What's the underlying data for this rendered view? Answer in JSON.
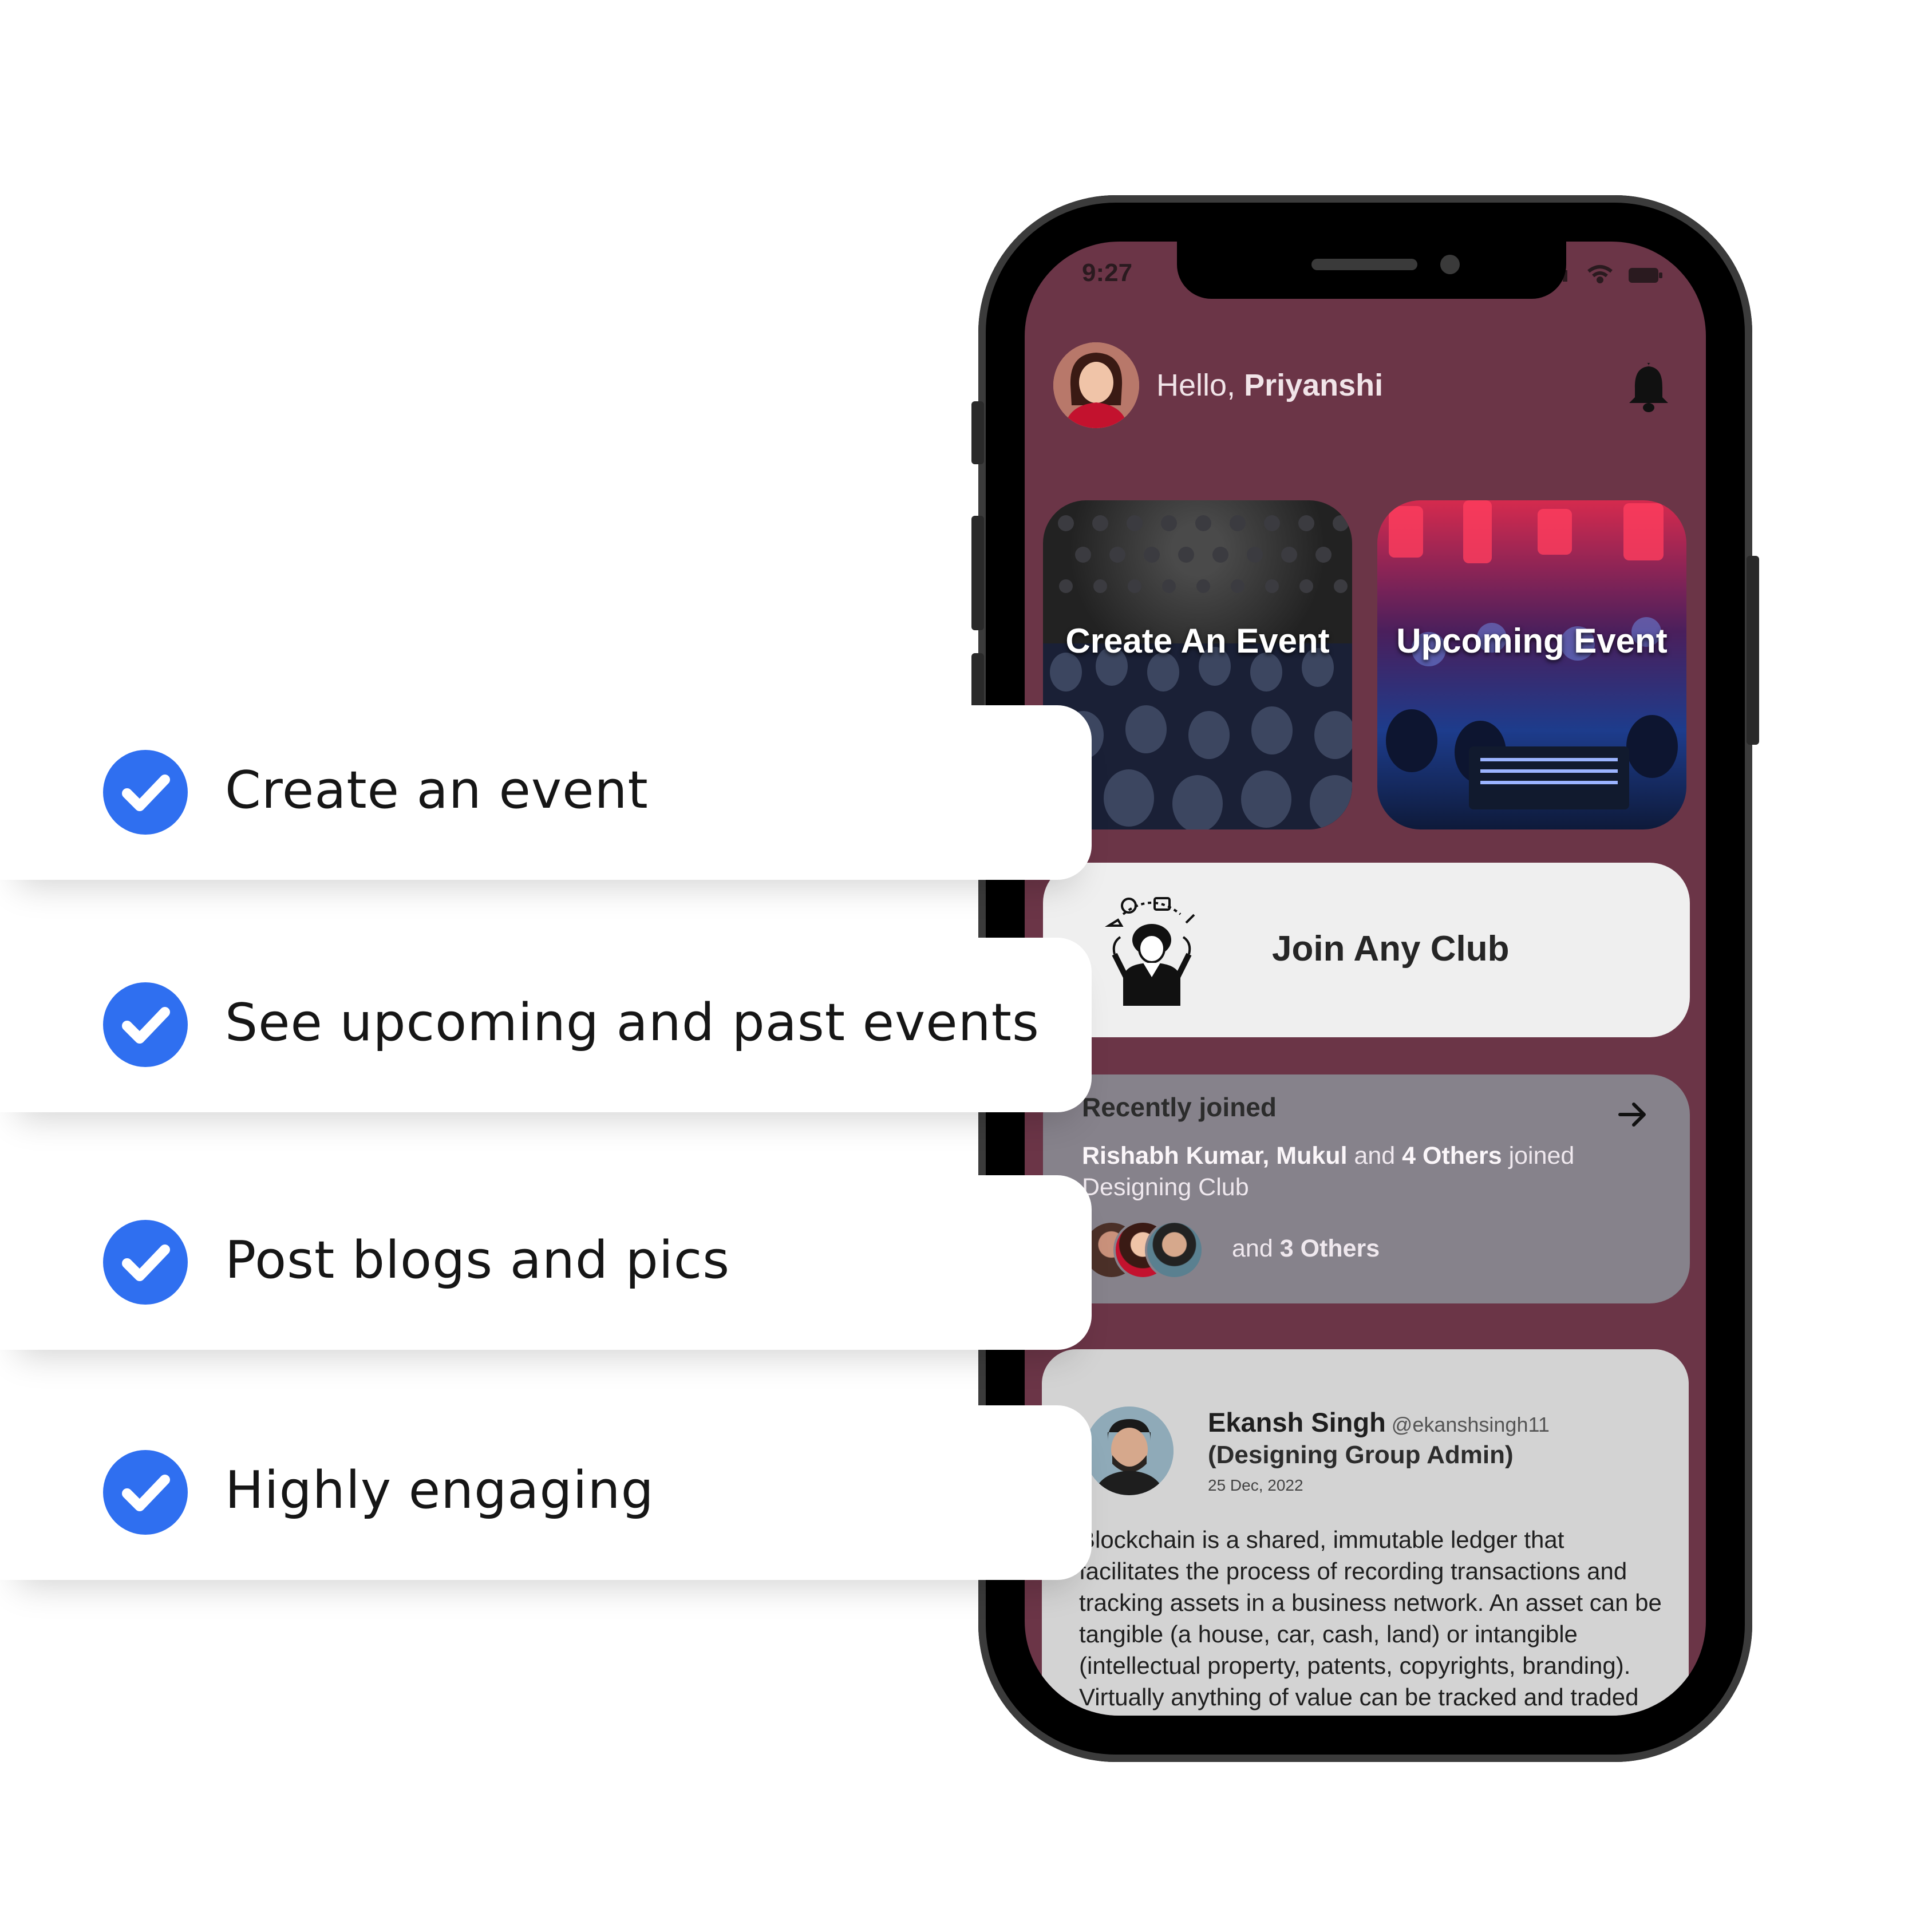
{
  "features": [
    {
      "label": "Create an event"
    },
    {
      "label": "See upcoming and past events"
    },
    {
      "label": "Post blogs and pics"
    },
    {
      "label": "Highly engaging"
    }
  ],
  "status_bar": {
    "time": "9:27"
  },
  "header": {
    "greeting": "Hello, ",
    "user_name": "Priyanshi"
  },
  "tiles": {
    "create_event": "Create An Event",
    "upcoming_event": "Upcoming Event"
  },
  "join_club": {
    "label": "Join Any Club"
  },
  "recently_joined": {
    "title": "Recently joined",
    "names": "Rishabh Kumar, Mukul",
    "mid": " and ",
    "count": "4 Others",
    "action": " joined Designing Club",
    "and_prefix": "and ",
    "others": "3 Others"
  },
  "post": {
    "author": "Ekansh Singh",
    "handle": "@ekanshsingh11",
    "role": "(Designing Group Admin)",
    "date": "25 Dec, 2022",
    "body": "Blockchain is a shared, immutable ledger that facilitates the process of recording transactions and tracking assets in a business network. An asset can be tangible (a house, car, cash, land) or intangible (intellectual property, patents, copyrights, branding). Virtually anything of value can be tracked and traded on a blockchain network, reducing risk and cutting costs for all involved."
  },
  "colors": {
    "screen_bg": "#6b3547",
    "check_blue": "#2f6ff0",
    "card_grey": "#86828b"
  },
  "icons": [
    "check-icon",
    "bell-icon",
    "arrow-right-icon",
    "wifi-icon",
    "battery-icon",
    "signal-icon"
  ]
}
